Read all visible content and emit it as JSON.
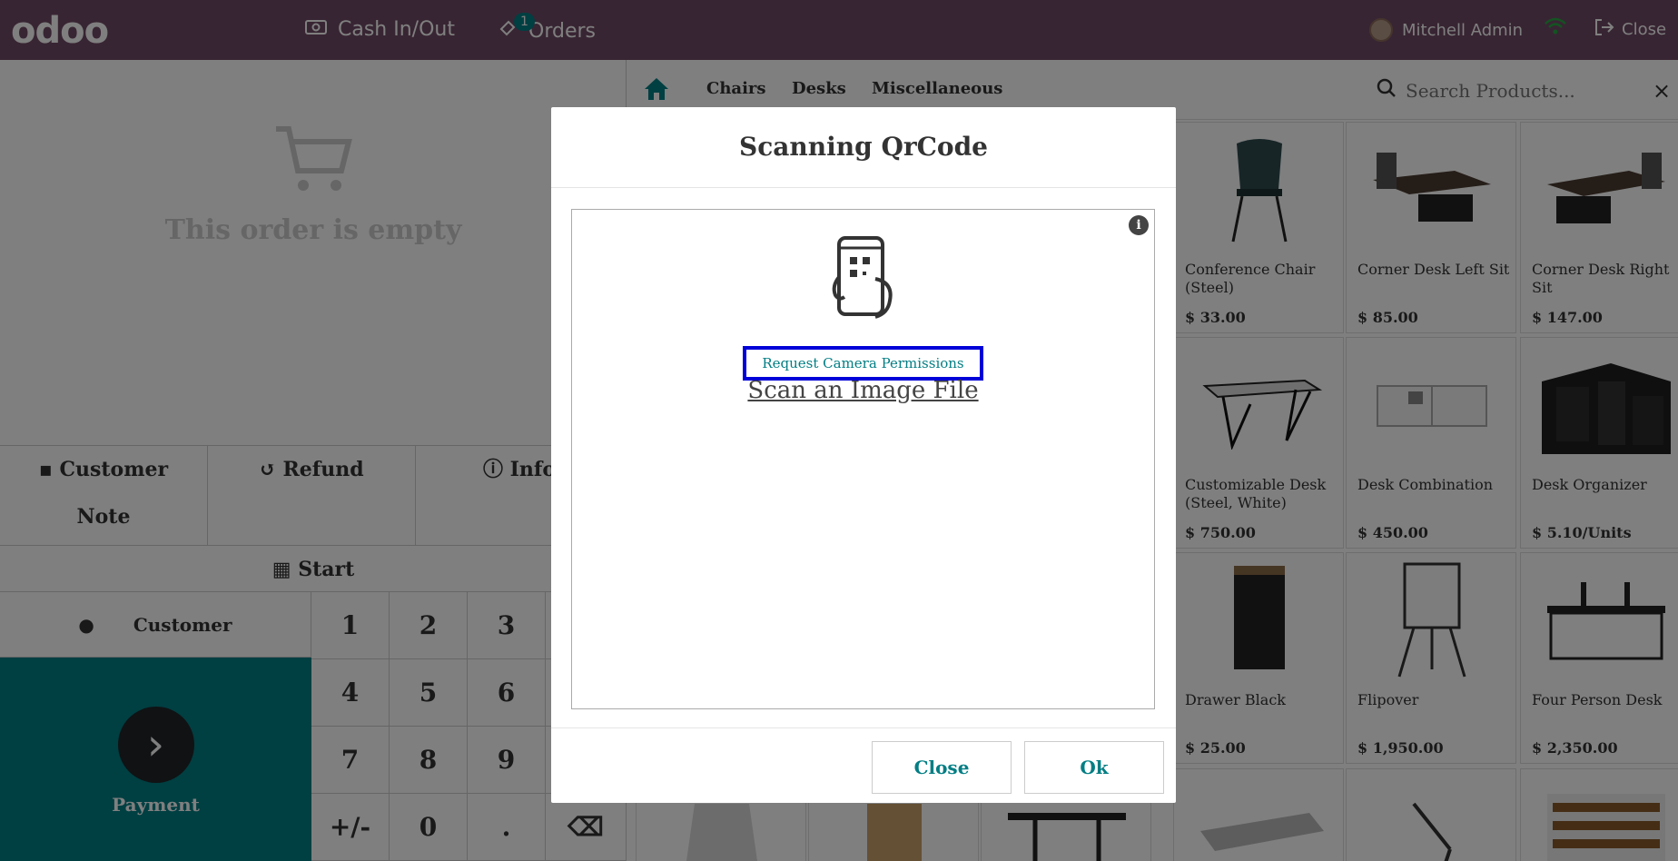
{
  "topbar": {
    "logo": "odoo",
    "cash_label": "Cash In/Out",
    "orders_label": "Orders",
    "orders_badge": "1",
    "user_name": "Mitchell Admin",
    "close_label": "Close"
  },
  "order": {
    "empty_text": "This order is empty"
  },
  "control_buttons": {
    "customer_note": "Customer Note",
    "refund": "Refund",
    "info": "Info",
    "start": "Start"
  },
  "customer_label": "Customer",
  "payment_label": "Payment",
  "numpad": [
    "1",
    "2",
    "3",
    "",
    "4",
    "5",
    "6",
    "",
    "7",
    "8",
    "9",
    "",
    "+/-",
    "0",
    ".",
    "⌫"
  ],
  "categories": {
    "chairs": "Chairs",
    "desks": "Desks",
    "misc": "Miscellaneous"
  },
  "search": {
    "placeholder": "Search Products..."
  },
  "products": [
    {
      "name": "Conference Chair (Steel)",
      "price": "$ 33.00"
    },
    {
      "name": "Corner Desk Left Sit",
      "price": "$ 85.00"
    },
    {
      "name": "Corner Desk Right Sit",
      "price": "$ 147.00"
    },
    {
      "name": "Customizable Desk (Steel, White)",
      "price": "$ 750.00"
    },
    {
      "name": "Desk Combination",
      "price": "$ 450.00"
    },
    {
      "name": "Desk Organizer",
      "price": "$ 5.10/Units"
    },
    {
      "name": "Drawer Black",
      "price": "$ 25.00"
    },
    {
      "name": "Flipover",
      "price": "$ 1,950.00"
    },
    {
      "name": "Four Person Desk",
      "price": "$ 2,350.00"
    }
  ],
  "modal": {
    "title": "Scanning QrCode",
    "request_button": "Request Camera Permissions",
    "scan_file_link": "Scan an Image File",
    "close_button": "Close",
    "ok_button": "Ok"
  },
  "colors": {
    "topbar": "#714b67",
    "accent": "#017e84",
    "highlight": "#0000d9"
  }
}
